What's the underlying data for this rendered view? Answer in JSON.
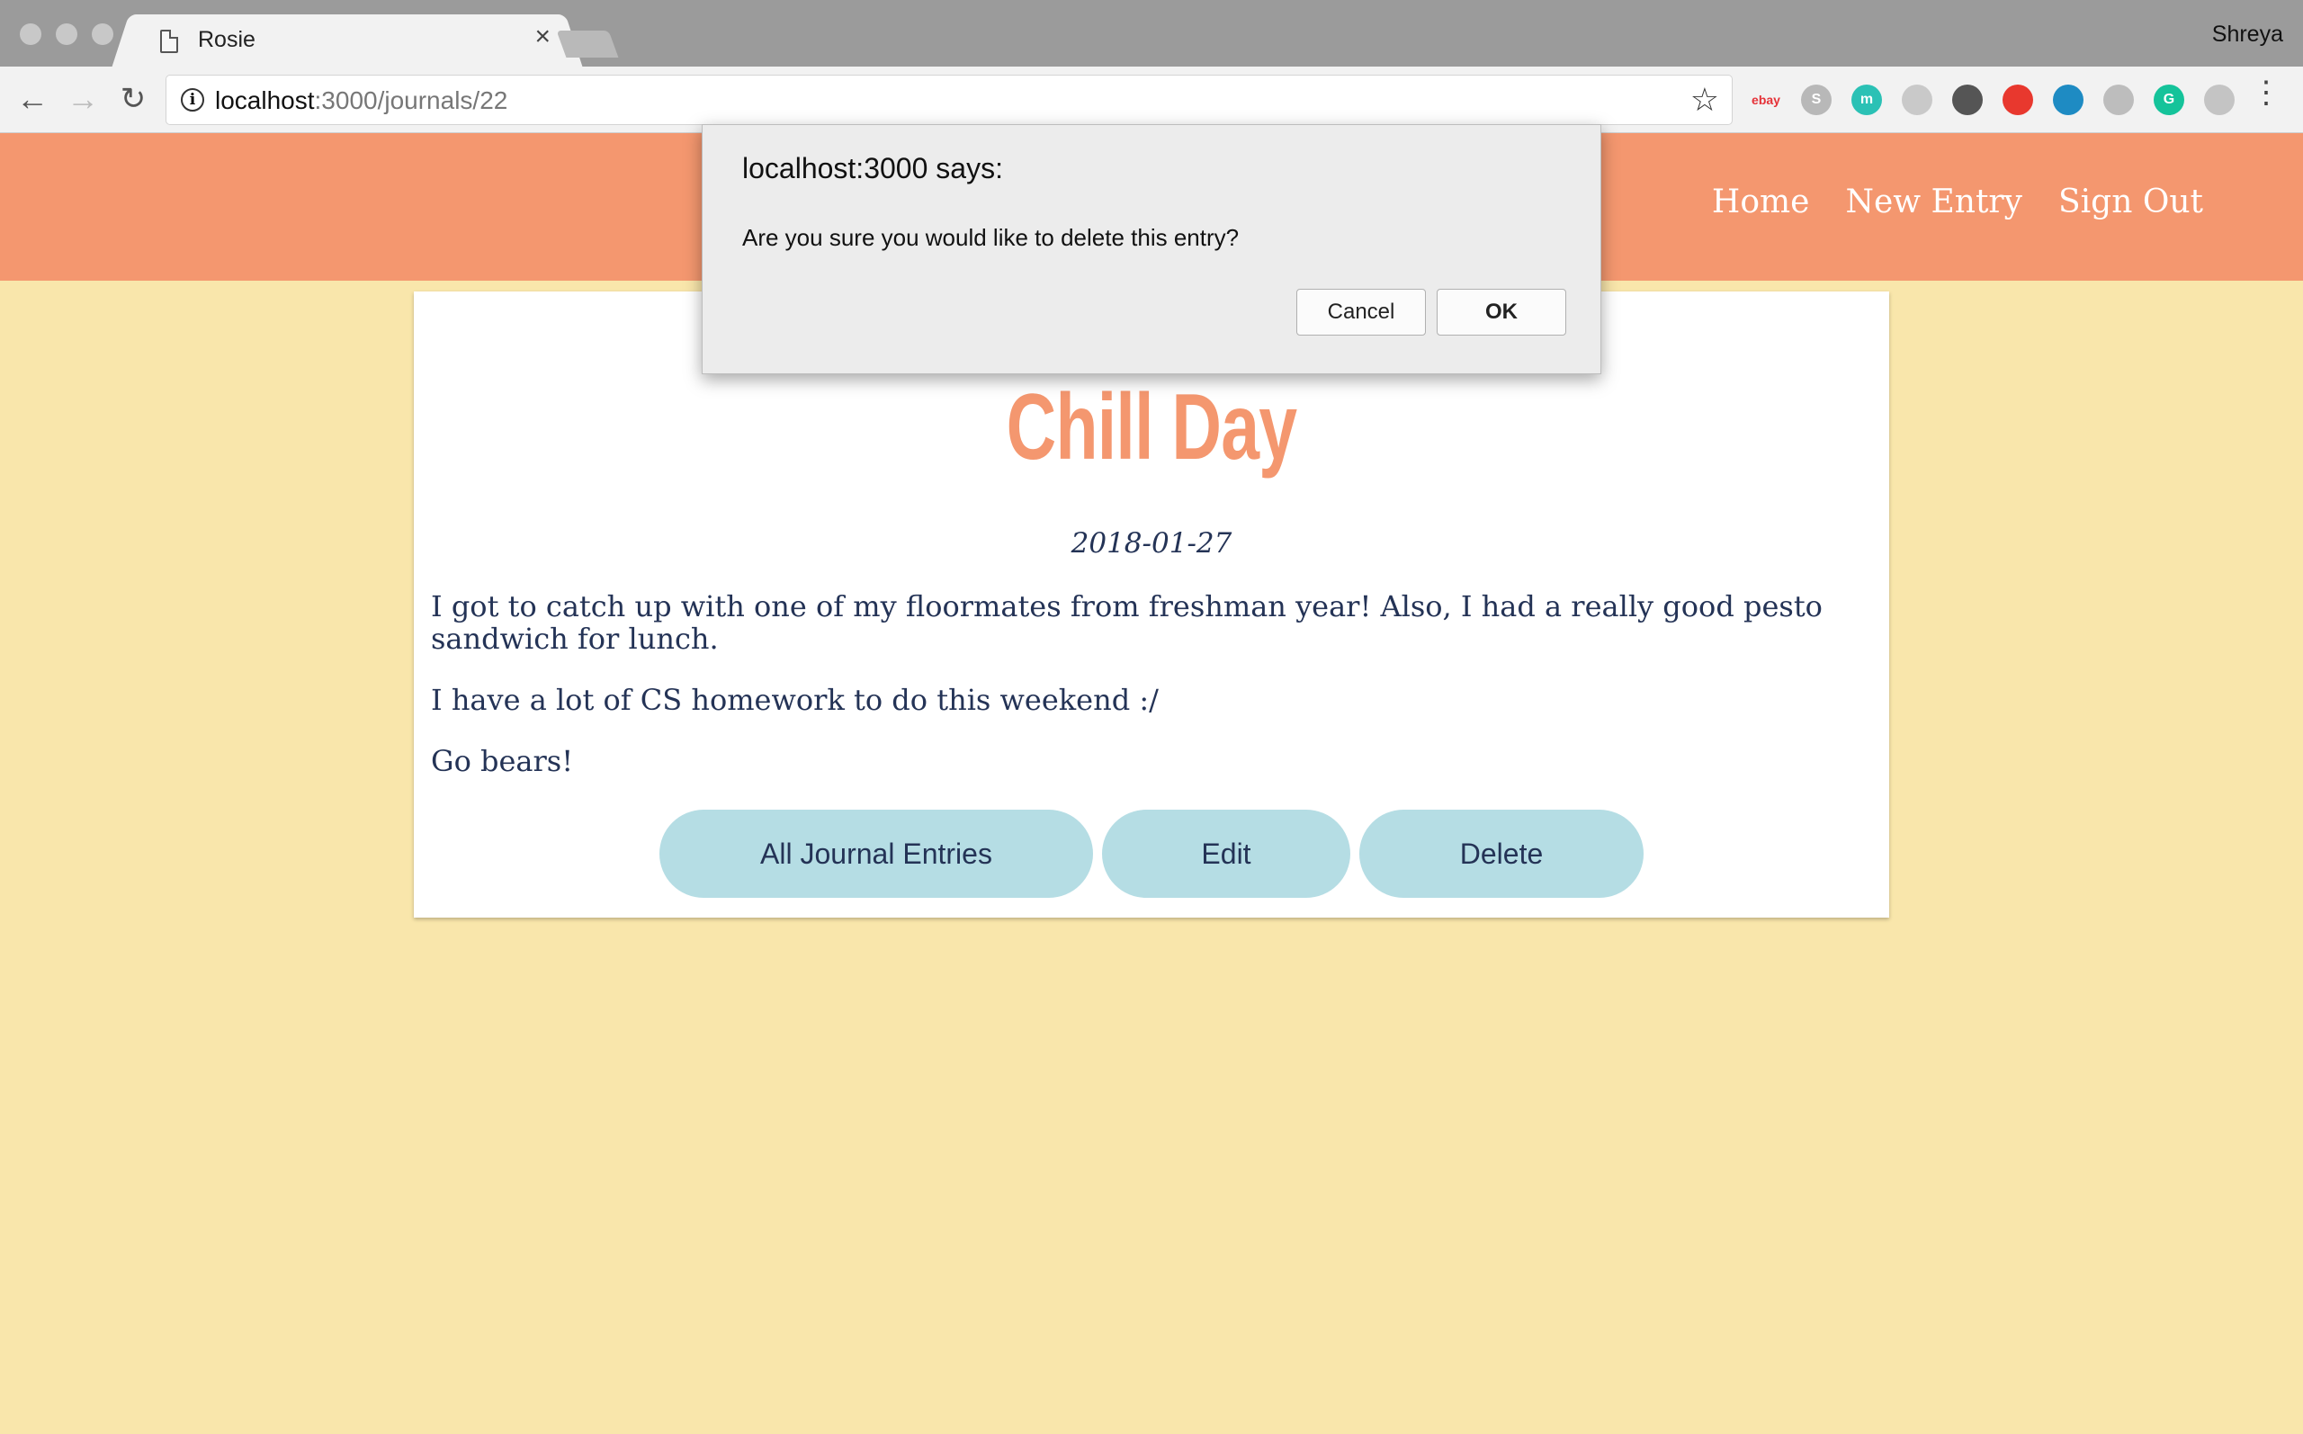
{
  "browser": {
    "tab_title": "Rosie",
    "profile_name": "Shreya",
    "url_host": "localhost",
    "url_path": ":3000/journals/22",
    "extensions": [
      {
        "name": "ebay-icon",
        "label": "ebay",
        "color": "#e53238"
      },
      {
        "name": "skype-icon",
        "label": "S",
        "color": "#b8b8b8"
      },
      {
        "name": "m-extension-icon",
        "label": "m",
        "color": "#2bc1b5"
      },
      {
        "name": "card-extension-icon",
        "label": "",
        "color": "#c9c9c9"
      },
      {
        "name": "evernote-icon",
        "label": "",
        "color": "#555555"
      },
      {
        "name": "adblock-icon",
        "label": "",
        "color": "#e8382e"
      },
      {
        "name": "eye-extension-icon",
        "label": "",
        "color": "#1e8bc3"
      },
      {
        "name": "paint-bucket-icon",
        "label": "",
        "color": "#bdbdbd"
      },
      {
        "name": "grammarly-icon",
        "label": "G",
        "color": "#15c39a"
      },
      {
        "name": "drive-icon",
        "label": "",
        "color": "#c4c4c4"
      }
    ]
  },
  "site_nav": {
    "home": "Home",
    "new_entry": "New Entry",
    "sign_out": "Sign Out"
  },
  "entry": {
    "title": "Chill Day",
    "date": "2018-01-27",
    "paragraphs": [
      "I got to catch up with one of my floormates from freshman year! Also, I had a really good pesto sandwich for lunch.",
      "I have a lot of CS homework to do this weekend :/",
      "Go bears!"
    ],
    "buttons": {
      "all_entries": "All Journal Entries",
      "edit": "Edit",
      "delete": "Delete"
    }
  },
  "dialog": {
    "title": "localhost:3000 says:",
    "message": "Are you sure you would like to delete this entry?",
    "cancel": "Cancel",
    "ok": "OK"
  },
  "colors": {
    "header": "#f4976f",
    "background": "#f9e6ab",
    "button": "#b5dde4",
    "text": "#243356"
  }
}
